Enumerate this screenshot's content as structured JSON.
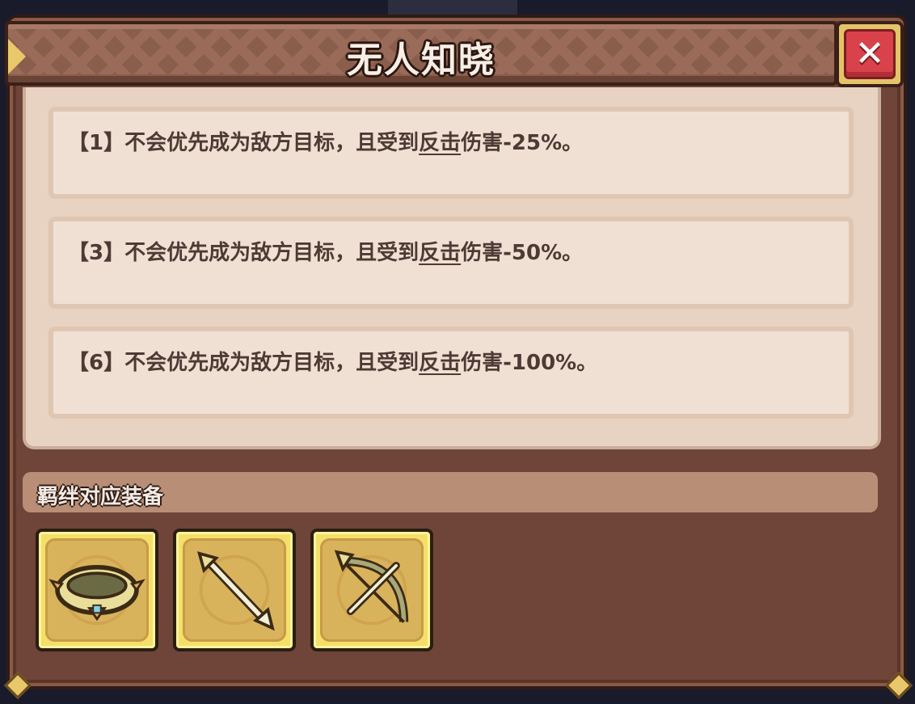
{
  "dialog": {
    "title": "无人知晓",
    "close_label": "✕"
  },
  "effects": [
    {
      "prefix": "【1】不会优先成为敌方目标，且受到",
      "keyword": "反击",
      "suffix": "伤害-25%。"
    },
    {
      "prefix": "【3】不会优先成为敌方目标，且受到",
      "keyword": "反击",
      "suffix": "伤害-50%。"
    },
    {
      "prefix": "【6】不会优先成为敌方目标，且受到",
      "keyword": "反击",
      "suffix": "伤害-100%。"
    }
  ],
  "bond_equipment": {
    "label": "羁绊对应装备",
    "items": [
      {
        "icon": "ring-icon"
      },
      {
        "icon": "arrow-icon"
      },
      {
        "icon": "crossbow-icon"
      }
    ]
  },
  "colors": {
    "panel": "#6e4538",
    "title_bar": "#8a5e4d",
    "close_red": "#d9424a",
    "entry_bg": "#f0e0d3",
    "slot_gold": "#f4df6a"
  }
}
